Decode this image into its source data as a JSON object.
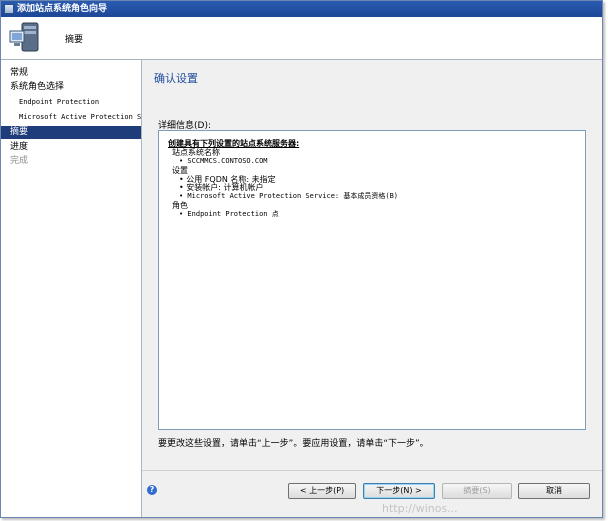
{
  "window": {
    "title": "添加站点系统角色向导"
  },
  "header": {
    "title": "摘要",
    "icon": "computer-server-icon"
  },
  "sidebar": {
    "items": [
      {
        "label": "常规"
      },
      {
        "label": "系统角色选择"
      },
      {
        "label": "Endpoint Protection"
      },
      {
        "label": "Microsoft Active Protection Se"
      },
      {
        "label": "摘要"
      },
      {
        "label": "进度"
      },
      {
        "label": "完成"
      }
    ],
    "active": "摘要"
  },
  "main": {
    "section_title": "确认设置",
    "details_label": "详细信息(D):",
    "details": {
      "heading": "创建具有下列设置的站点系统服务器:",
      "server_label": "站点系统名称",
      "server_name": "• SCCMMCS.CONTOSO.COM",
      "settings_label": "设置",
      "setting_fqdn": "• 公用 FQDN 名称: 未指定",
      "setting_account": "• 安装帐户: 计算机帐户",
      "setting_maps": "• Microsoft Active Protection Service: 基本成员资格(B)",
      "roles_label": "角色",
      "role_ep": "• Endpoint Protection 点"
    },
    "instruction": "要更改这些设置，请单击“上一步”。要应用设置，请单击“下一步”。"
  },
  "buttons": {
    "prev": "< 上一步(P)",
    "next": "下一步(N) >",
    "summary": "摘要(S)",
    "cancel": "取消"
  },
  "watermark": "http://winos..."
}
